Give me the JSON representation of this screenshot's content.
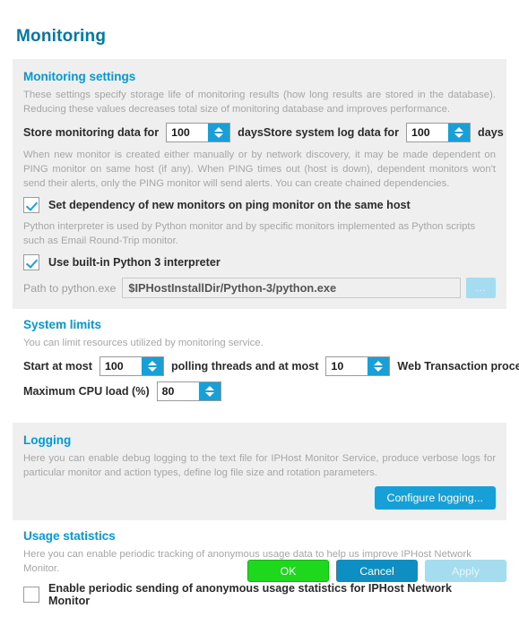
{
  "page": {
    "title": "Monitoring"
  },
  "monitoring_settings": {
    "heading": "Monitoring settings",
    "description": "These settings specify storage life of monitoring results (how long results are stored in the database). Reducing these values decreases total size of monitoring database and improves performance.",
    "store_monitoring_label": "Store monitoring data for",
    "store_monitoring_value": "100",
    "store_monitoring_unit": "days",
    "store_syslog_label": "Store system log data for",
    "store_syslog_value": "100",
    "store_syslog_unit": "days",
    "dependency_description": "When new monitor is created either manually or by network discovery, it may be made dependent on PING monitor on same host (if any). When PING times out (host is down), dependent monitors won't send their alerts, only the PING monitor will send alerts. You can create chained dependencies.",
    "dependency_checkbox_label": "Set dependency of new monitors on ping monitor on the same host",
    "dependency_checked": true,
    "python_description": "Python interpreter is used by Python monitor and by specific monitors implemented as Python scripts such as Email Round-Trip monitor.",
    "python_checkbox_label": "Use built-in Python 3 interpreter",
    "python_checked": true,
    "path_label": "Path to python.exe",
    "path_value": "$IPHostInstallDir/Python-3/python.exe",
    "browse_label": "..."
  },
  "system_limits": {
    "heading": "System limits",
    "description": "You can limit resources utilized by monitoring service.",
    "threads_prefix": "Start at most",
    "threads_value": "100",
    "threads_middle": "polling threads and at most",
    "processes_value": "10",
    "processes_suffix": "Web Transaction processes",
    "cpu_label": "Maximum CPU load (%)",
    "cpu_value": "80"
  },
  "logging": {
    "heading": "Logging",
    "description": "Here you can enable debug logging to the text file for IPHost Monitor Service, produce verbose logs for particular monitor and action types, define log file size and rotation parameters.",
    "configure_button": "Configure logging..."
  },
  "usage_statistics": {
    "heading": "Usage statistics",
    "description": "Here you can enable periodic tracking of anonymous usage data to help us improve IPHost Network Monitor.",
    "checkbox_label": "Enable periodic sending of anonymous usage statistics for IPHost Network Monitor",
    "checked": false
  },
  "footer": {
    "ok_label": "OK",
    "cancel_label": "Cancel",
    "apply_label": "Apply"
  },
  "colors": {
    "accent": "#009ad8",
    "title": "#0078a8",
    "ok_green": "#1ed81e",
    "cancel_blue": "#0d8fc4",
    "disabled_blue": "#a6dcef",
    "panel_gray": "#efefef"
  }
}
